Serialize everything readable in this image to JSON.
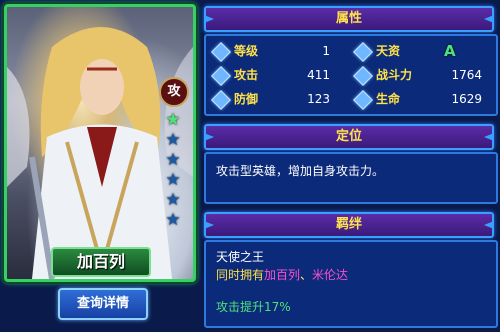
{
  "hero": {
    "name": "加百列",
    "type_badge": "攻",
    "stars_total": 6,
    "stars_lit": 1,
    "detail_button": "查询详情"
  },
  "attributes": {
    "header": "属性",
    "rows": [
      {
        "label": "等级",
        "value": "1"
      },
      {
        "label": "攻击",
        "value": "411"
      },
      {
        "label": "防御",
        "value": "123"
      }
    ],
    "rows_right": [
      {
        "label": "天资",
        "value": "A"
      },
      {
        "label": "战斗力",
        "value": "1764"
      },
      {
        "label": "生命",
        "value": "1629"
      }
    ]
  },
  "role": {
    "header": "定位",
    "text": "攻击型英雄，增加自身攻击力。"
  },
  "bond": {
    "header": "羁绊",
    "name": "天使之王",
    "prefix": "同时拥有",
    "hero1": "加百列",
    "separator": "、",
    "hero2": "米伦达",
    "effect": "攻击提升17%"
  },
  "colors": {
    "label": "#ffe14a",
    "highlight": "#4ee27a",
    "hero_name_link": "#ff4fcf",
    "panel_bg": "#0b2a7a",
    "header_bg": "#5b2ca8"
  }
}
